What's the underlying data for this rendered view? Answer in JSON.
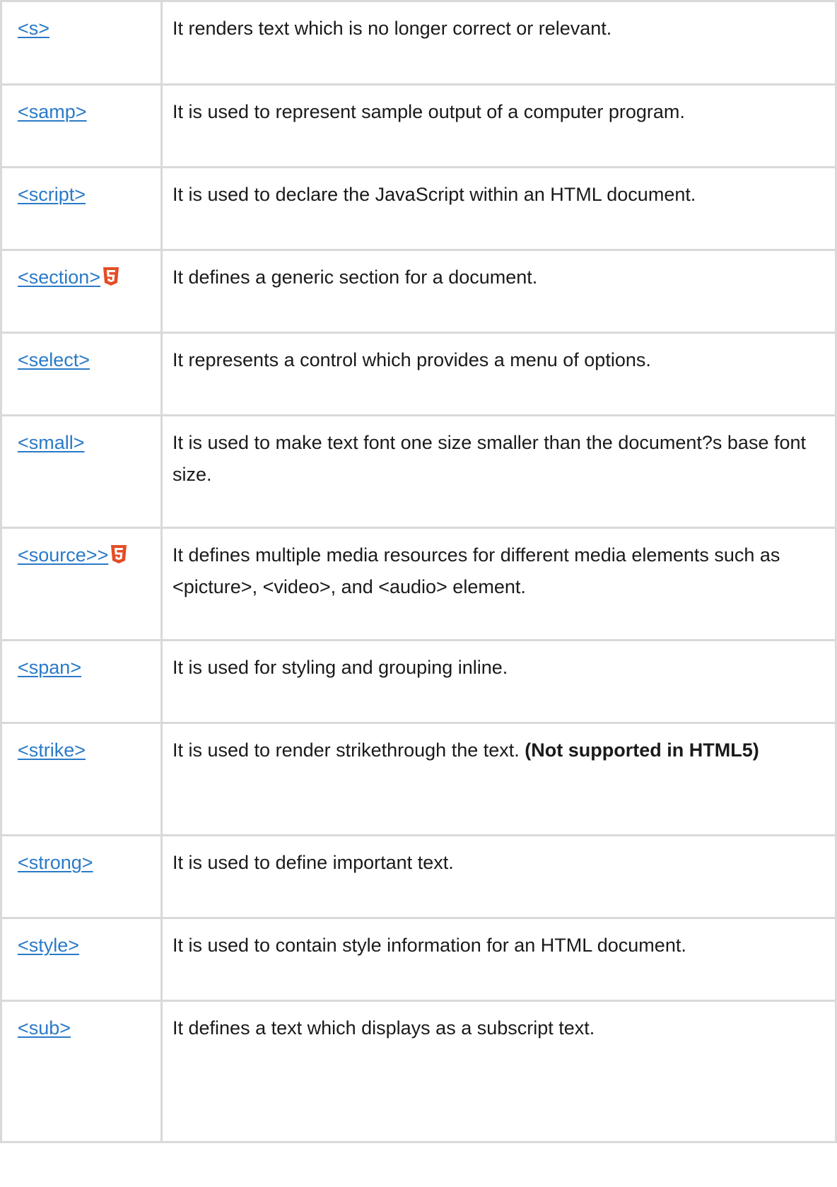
{
  "rows": [
    {
      "tag": "<s>",
      "desc": "It renders text which is no longer correct or relevant.",
      "html5": false,
      "height": 118
    },
    {
      "tag": "<samp>",
      "desc": "It is used to represent sample output of a computer program.",
      "html5": false,
      "height": 117
    },
    {
      "tag": "<script>",
      "desc": "It is used to declare the JavaScript within an HTML document.",
      "html5": false,
      "height": 117
    },
    {
      "tag": "<section>",
      "desc": "It defines a generic section for a document.",
      "html5": true,
      "height": 117
    },
    {
      "tag": "<select>",
      "desc": "It represents a control which provides a menu of options.",
      "html5": false,
      "height": 117
    },
    {
      "tag": "<small>",
      "desc": "It is used to make text font one size smaller than the document?s base font size.",
      "html5": false,
      "height": 159
    },
    {
      "tag": "<source>>",
      "desc": "It defines multiple media resources for different media elements such as <picture>, <video>, and <audio> element.",
      "html5": true,
      "height": 159
    },
    {
      "tag": "<span>",
      "desc": "It is used for styling and grouping inline.",
      "html5": false,
      "height": 117
    },
    {
      "tag": "<strike>",
      "desc": "It is used to render strikethrough the text. ",
      "strong": "(Not supported in HTML5)",
      "html5": false,
      "height": 159
    },
    {
      "tag": "<strong>",
      "desc": "It is used to define important text.",
      "html5": false,
      "height": 117
    },
    {
      "tag": "<style>",
      "desc": "It is used to contain style information for an HTML document.",
      "html5": false,
      "height": 117
    },
    {
      "tag": "<sub>",
      "desc": "It defines a text which displays as a subscript text.",
      "html5": false,
      "height": 200
    }
  ],
  "colors": {
    "link": "#2a7ac8",
    "border": "#d9d9d9",
    "html5_badge": "#e44d26"
  },
  "icons": {
    "html5_badge": "html5-logo-icon"
  }
}
